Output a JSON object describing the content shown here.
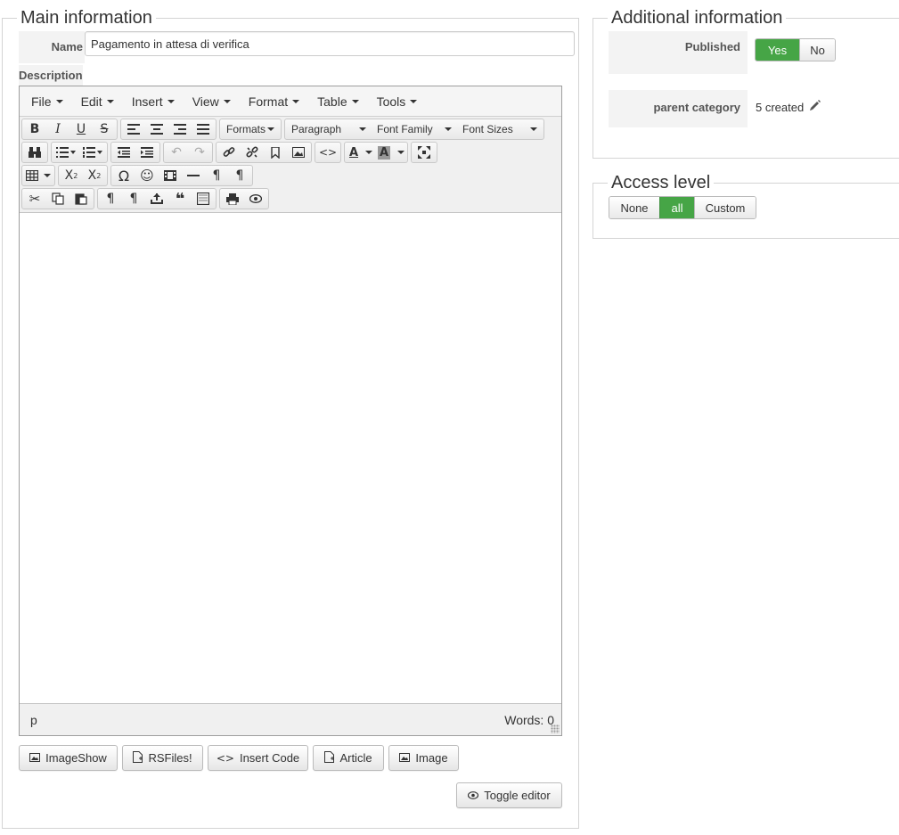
{
  "main": {
    "legend": "Main information",
    "name_label": "Name",
    "name_value": "Pagamento in attesa di verifica",
    "description_label": "Description"
  },
  "editor": {
    "menu": [
      "File",
      "Edit",
      "Insert",
      "View",
      "Format",
      "Table",
      "Tools"
    ],
    "listboxes": {
      "formats": "Formats",
      "paragraph": "Paragraph",
      "font_family": "Font Family",
      "font_sizes": "Font Sizes"
    },
    "status_path": "p",
    "word_count": "Words: 0"
  },
  "editor_buttons": {
    "imageshow": "ImageShow",
    "rsfiles": "RSFiles!",
    "insert_code": "Insert Code",
    "article": "Article",
    "image": "Image",
    "toggle_editor": "Toggle editor"
  },
  "additional": {
    "legend": "Additional information",
    "published_label": "Published",
    "published_yes": "Yes",
    "published_no": "No",
    "published_value": "Yes",
    "parent_label": "parent category",
    "parent_value": "5 created"
  },
  "access": {
    "legend": "Access level",
    "options": [
      "None",
      "all",
      "Custom"
    ],
    "selected": "all"
  },
  "colors": {
    "active_green": "#46a546",
    "border": "#d4d4d4"
  }
}
